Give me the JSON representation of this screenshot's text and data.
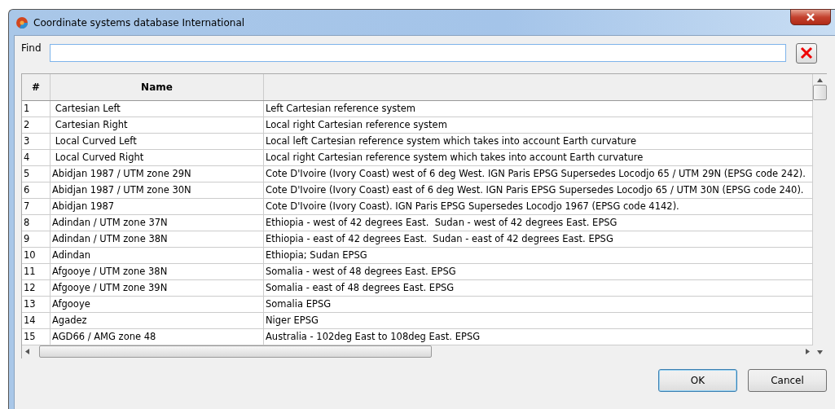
{
  "window": {
    "title": "Coordinate systems database International"
  },
  "find": {
    "label": "Find"
  },
  "table": {
    "columns": [
      "#",
      "Name",
      ""
    ],
    "rows": [
      [
        "1",
        " Cartesian Left",
        "Left Cartesian reference system"
      ],
      [
        "2",
        " Cartesian Right",
        "Local right Cartesian reference system"
      ],
      [
        "3",
        " Local Curved Left",
        "Local left Cartesian reference system which takes into account Earth curvature"
      ],
      [
        "4",
        " Local Curved Right",
        "Local right Cartesian reference system which takes into account Earth curvature"
      ],
      [
        "5",
        "Abidjan 1987 / UTM zone 29N",
        "Cote D'Ivoire (Ivory Coast) west of 6 deg West. IGN Paris EPSG Supersedes Locodjo 65 / UTM 29N (EPSG code 242)."
      ],
      [
        "6",
        "Abidjan 1987 / UTM zone 30N",
        "Cote D'Ivoire (Ivory Coast) east of 6 deg West. IGN Paris EPSG Supersedes Locodjo 65 / UTM 30N (EPSG code 240)."
      ],
      [
        "7",
        "Abidjan 1987",
        "Cote D'Ivoire (Ivory Coast). IGN Paris EPSG Supersedes Locodjo 1967 (EPSG code 4142)."
      ],
      [
        "8",
        "Adindan / UTM zone 37N",
        "Ethiopia - west of 42 degrees East.  Sudan - west of 42 degrees East. EPSG"
      ],
      [
        "9",
        "Adindan / UTM zone 38N",
        "Ethiopia - east of 42 degrees East.  Sudan - east of 42 degrees East. EPSG"
      ],
      [
        "10",
        "Adindan",
        "Ethiopia; Sudan EPSG"
      ],
      [
        "11",
        "Afgooye / UTM zone 38N",
        "Somalia - west of 48 degrees East. EPSG"
      ],
      [
        "12",
        "Afgooye / UTM zone 39N",
        "Somalia - east of 48 degrees East. EPSG"
      ],
      [
        "13",
        "Afgooye",
        "Somalia EPSG"
      ],
      [
        "14",
        "Agadez",
        "Niger EPSG"
      ],
      [
        "15",
        "AGD66 / AMG zone 48",
        "Australia - 102deg East to 108deg East. EPSG"
      ]
    ]
  },
  "buttons": [
    {
      "label": "OK",
      "default": true
    },
    {
      "label": "Cancel",
      "default": false
    }
  ]
}
